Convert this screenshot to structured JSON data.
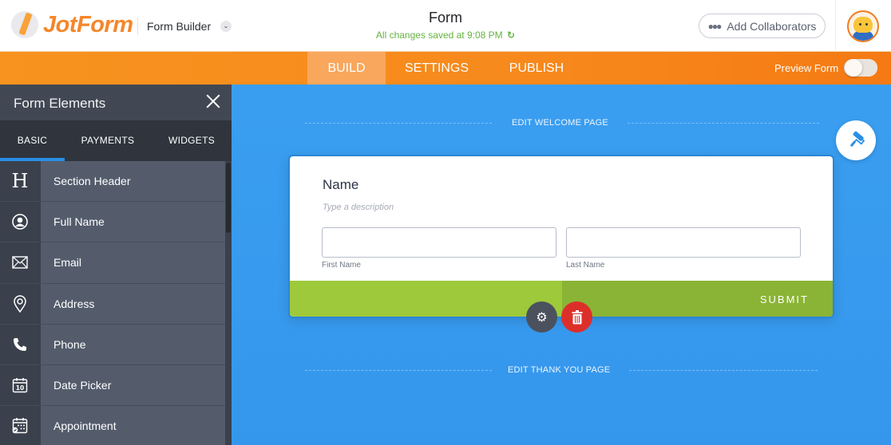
{
  "header": {
    "logo_text": "JotForm",
    "builder_label": "Form Builder",
    "form_title": "Form",
    "save_status": "All changes saved at 9:08 PM",
    "add_collaborators_label": "Add Collaborators"
  },
  "nav": {
    "tabs": [
      {
        "label": "BUILD",
        "active": true
      },
      {
        "label": "SETTINGS",
        "active": false
      },
      {
        "label": "PUBLISH",
        "active": false
      }
    ],
    "preview_label": "Preview Form",
    "preview_enabled": false
  },
  "sidebar": {
    "title": "Form Elements",
    "tabs": [
      {
        "label": "BASIC",
        "active": true
      },
      {
        "label": "PAYMENTS",
        "active": false
      },
      {
        "label": "WIDGETS",
        "active": false
      }
    ],
    "items": [
      {
        "label": "Section Header",
        "icon": "heading-icon"
      },
      {
        "label": "Full Name",
        "icon": "user-circle-icon"
      },
      {
        "label": "Email",
        "icon": "envelope-icon"
      },
      {
        "label": "Address",
        "icon": "map-pin-icon"
      },
      {
        "label": "Phone",
        "icon": "phone-icon"
      },
      {
        "label": "Date Picker",
        "icon": "calendar-icon"
      },
      {
        "label": "Appointment",
        "icon": "appointment-calendar-icon"
      }
    ]
  },
  "canvas": {
    "edit_welcome_label": "EDIT WELCOME PAGE",
    "edit_thankyou_label": "EDIT THANK YOU PAGE",
    "question": {
      "label": "Name",
      "description_placeholder": "Type a description",
      "first_name_value": "",
      "last_name_value": "",
      "first_name_sublabel": "First Name",
      "last_name_sublabel": "Last Name"
    },
    "submit_label": "SUBMIT"
  },
  "colors": {
    "brand_orange": "#f7931e",
    "canvas_blue": "#3a9ef0",
    "submit_green": "#9ec93b",
    "delete_red": "#dd2f2a",
    "save_green": "#64b33f"
  }
}
